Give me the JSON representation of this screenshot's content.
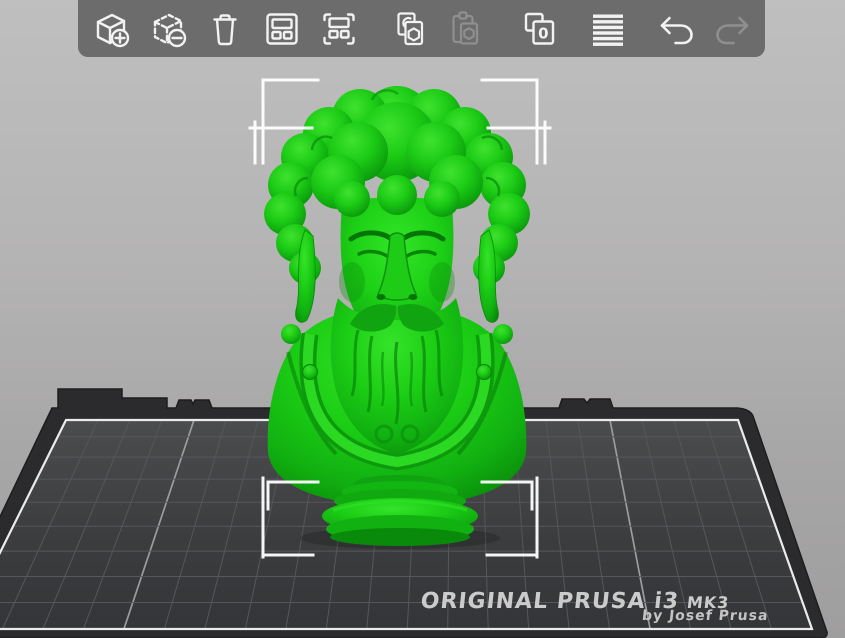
{
  "toolbar": {
    "background_color": "#6c6c6c",
    "icon_color": "#f2f2f2",
    "disabled_icon_color": "#8f8f8f",
    "buttons": [
      {
        "id": "add",
        "label": "Add object",
        "icon": "box-plus-icon",
        "enabled": true
      },
      {
        "id": "delete",
        "label": "Delete object",
        "icon": "box-minus-icon",
        "enabled": true
      },
      {
        "id": "delete-all",
        "label": "Delete all",
        "icon": "trash-icon",
        "enabled": true
      },
      {
        "id": "arrange",
        "label": "Arrange",
        "icon": "arrange-icon",
        "enabled": true
      },
      {
        "id": "arrange-selection",
        "label": "Arrange selection",
        "icon": "arrange-selection-icon",
        "enabled": true
      },
      {
        "id": "copy",
        "label": "Copy",
        "icon": "copy-icon",
        "enabled": true
      },
      {
        "id": "paste",
        "label": "Paste",
        "icon": "paste-icon",
        "enabled": false
      },
      {
        "id": "instances",
        "label": "Instances",
        "icon": "instances-icon",
        "enabled": true,
        "badge": "0"
      },
      {
        "id": "layers",
        "label": "Layer height",
        "icon": "layers-icon",
        "enabled": true
      },
      {
        "id": "undo",
        "label": "Undo",
        "icon": "undo-icon",
        "enabled": true
      },
      {
        "id": "redo",
        "label": "Redo",
        "icon": "redo-icon",
        "enabled": false
      }
    ]
  },
  "bed": {
    "brand_line": "ORIGINAL PRUSA i3",
    "brand_model": "MK3",
    "byline": "by Josef Prusa",
    "surface_color": "#3c3d3f",
    "frame_color": "#2b2b2d",
    "grid_color": "#56575b",
    "grid_major_color": "#9b9c9f",
    "border_color": "#ebebeb",
    "label_color": "#cbcbcb"
  },
  "model": {
    "name": "bust",
    "color": "#16c315",
    "highlight_color": "#35e42a",
    "shadow_color": "#077807",
    "selected": true,
    "selection_color": "#ffffff"
  },
  "background": {
    "top": "#bfbfbf",
    "bottom": "#9f9e9e"
  }
}
